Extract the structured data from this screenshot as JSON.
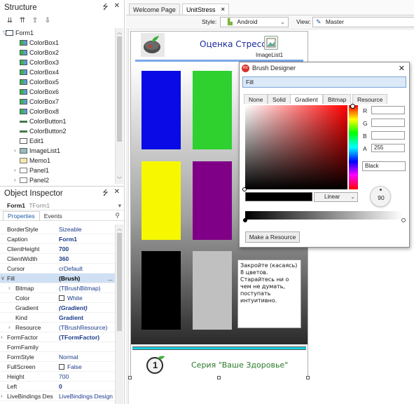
{
  "structure": {
    "title": "Structure",
    "pin": "⭍",
    "close": "✕",
    "items": [
      {
        "label": "Form1",
        "icon": "form-icon",
        "indent": 0,
        "expand": "▽"
      },
      {
        "label": "ColorBox1",
        "icon": "colorbox-icon",
        "indent": 1
      },
      {
        "label": "ColorBox2",
        "icon": "colorbox-icon",
        "indent": 1
      },
      {
        "label": "ColorBox3",
        "icon": "colorbox-icon",
        "indent": 1
      },
      {
        "label": "ColorBox4",
        "icon": "colorbox-icon",
        "indent": 1
      },
      {
        "label": "ColorBox5",
        "icon": "colorbox-icon",
        "indent": 1
      },
      {
        "label": "ColorBox6",
        "icon": "colorbox-icon",
        "indent": 1
      },
      {
        "label": "ColorBox7",
        "icon": "colorbox-icon",
        "indent": 1
      },
      {
        "label": "ColorBox8",
        "icon": "colorbox-icon",
        "indent": 1
      },
      {
        "label": "ColorButton1",
        "icon": "colorbutton-icon",
        "indent": 1
      },
      {
        "label": "ColorButton2",
        "icon": "colorbutton-icon",
        "indent": 1
      },
      {
        "label": "Edit1",
        "icon": "edit-icon",
        "indent": 1
      },
      {
        "label": "ImageList1",
        "icon": "imagelist-icon",
        "indent": 1,
        "expand": "›"
      },
      {
        "label": "Memo1",
        "icon": "memo-icon",
        "indent": 1
      },
      {
        "label": "Panel1",
        "icon": "panel-icon",
        "indent": 1,
        "expand": "›"
      },
      {
        "label": "Panel2",
        "icon": "panel-icon",
        "indent": 1,
        "expand": "›"
      }
    ]
  },
  "inspector": {
    "title": "Object Inspector",
    "object_name": "Form1",
    "object_type": "TForm1",
    "tabs": [
      "Properties",
      "Events"
    ],
    "rows": [
      {
        "name": "BorderStyle",
        "value": "Sizeable"
      },
      {
        "name": "Caption",
        "value": "Form1",
        "bold": true
      },
      {
        "name": "ClientHeight",
        "value": "700",
        "bold": true
      },
      {
        "name": "ClientWidth",
        "value": "360",
        "bold": true
      },
      {
        "name": "Cursor",
        "value": "crDefault"
      },
      {
        "name": "Fill",
        "value": "(Brush)",
        "bold": true,
        "sel": true,
        "expand": "∨",
        "more": "..."
      },
      {
        "name": "Bitmap",
        "value": "(TBrushBitmap)",
        "sub": true,
        "expand": "›"
      },
      {
        "name": "Color",
        "value": "White",
        "sub": true,
        "swatch": true
      },
      {
        "name": "Gradient",
        "value": "(Gradient)",
        "sub": true,
        "bold": true,
        "italic": true
      },
      {
        "name": "Kind",
        "value": "Gradient",
        "sub": true,
        "bold": true
      },
      {
        "name": "Resource",
        "value": "(TBrushResource)",
        "sub": true,
        "expand": "›"
      },
      {
        "name": "FormFactor",
        "value": "(TFormFactor)",
        "bold": true,
        "expand": "›"
      },
      {
        "name": "FormFamily",
        "value": ""
      },
      {
        "name": "FormStyle",
        "value": "Normal"
      },
      {
        "name": "FullScreen",
        "value": "False",
        "check": true
      },
      {
        "name": "Height",
        "value": "700"
      },
      {
        "name": "Left",
        "value": "0",
        "bold": true
      },
      {
        "name": "LiveBindings Des",
        "value": "LiveBindings Design",
        "expand": "›"
      }
    ]
  },
  "editor": {
    "tabs": [
      "Welcome Page",
      "UnitStress"
    ],
    "tab_close": "✕",
    "style_label": "Style:",
    "style_value": "Android",
    "view_label": "View:",
    "view_value": "Master"
  },
  "form": {
    "header_title": "Оценка Стресса",
    "imagelist_label": "ImageList1",
    "memo_text": "Закройте (касаясь) 8 цветов. Старайтесь ни о чем не думать, поступать интуитивно.",
    "footer_title": "Серия \"Ваше Здоровье\"",
    "footer_icon": "1",
    "blocks": [
      {
        "color": "#0a0ae6"
      },
      {
        "color": "#2ed12e"
      },
      {
        "color": "#f7f700"
      },
      {
        "color": "#7f0087"
      },
      {
        "color": "#000000"
      },
      {
        "color": "#c0c0c0"
      }
    ]
  },
  "brush_designer": {
    "title": "Brush Designer",
    "close": "✕",
    "target": "Fill",
    "tabs": [
      "None",
      "Solid",
      "Gradient",
      "Bitmap",
      "Resource"
    ],
    "active_tab": "Gradient",
    "r_label": "R",
    "g_label": "G",
    "b_label": "B",
    "a_label": "A",
    "r_value": "",
    "g_value": "",
    "b_value": "",
    "a_value": "255",
    "color_name": "Black",
    "kind": "Linear",
    "angle": "90",
    "make_resource": "Make a Resource"
  }
}
